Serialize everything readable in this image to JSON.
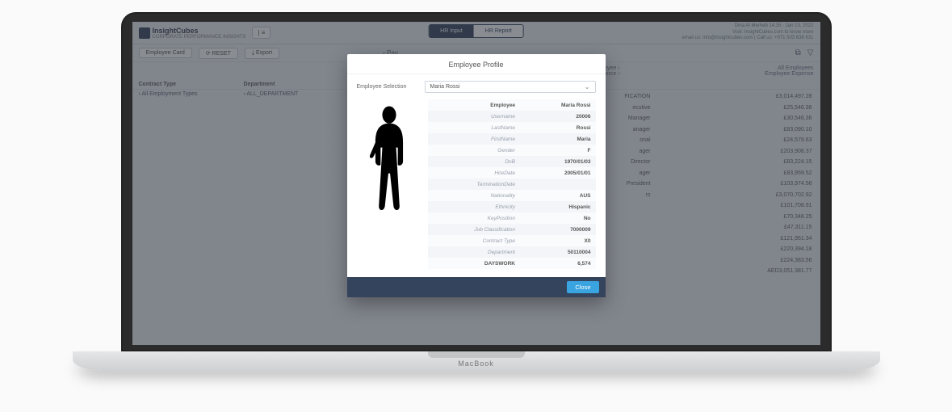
{
  "brand": {
    "name": "InsightCubes",
    "tagline": "CORPORATE PERFORMANCE INSIGHTS"
  },
  "nav": {
    "input": "HR Input",
    "report": "HR Report"
  },
  "header_info": {
    "line1": "Dina Al Merheb    14:35 · Jan 13, 2022",
    "line2": "Visit: InsightCubes.com to know more",
    "line3": "email us: info@insightcubes.com | Call us: +971 503 638 631"
  },
  "toolbar": {
    "employee_card": "Employee Card",
    "reset": "⟳ RESET",
    "export": "⤓ Export",
    "pav_label": "Pav"
  },
  "crumbs": {
    "employee": "Employee",
    "accounts": "Accounts · Manpower & Workforce",
    "all_employees": "All Employees",
    "employee_expense": "Employee Expense"
  },
  "columns": {
    "contract_type": "Contract Type",
    "department": "Department"
  },
  "first_row": {
    "ct": "› All Employment Types",
    "dep": "› ALL_DEPARTMENT"
  },
  "midlabels": [
    "",
    "",
    "FICATION",
    "",
    "",
    "",
    "ecutive",
    "",
    "Manager",
    "anager",
    "",
    "",
    "onal",
    "ager",
    "Director",
    "ager",
    "President",
    "rs"
  ],
  "amounts": [
    "£3,014,497.28",
    "£25,546.36",
    "£30,546.36",
    "£83,090.10",
    "£24,579.63",
    "£203,908.37",
    "£83,224.15",
    "£83,959.52",
    "£103,974.56",
    "£3,070,702.92",
    "£101,708.91",
    "£70,348.25",
    "£47,311.15",
    "£121,951.34",
    "£220,394.18",
    "£224,383.56",
    "AED3,051,381.77"
  ],
  "modal": {
    "title": "Employee Profile",
    "selection_label": "Employee Selection",
    "selected": "Maria Rossi",
    "close": "Close",
    "rows": [
      {
        "label": "Employee",
        "value": "Maria Rossi",
        "strong": true
      },
      {
        "label": "Username",
        "value": "20006"
      },
      {
        "label": "LastName",
        "value": "Rossi"
      },
      {
        "label": "FirstName",
        "value": "Maria"
      },
      {
        "label": "Gender",
        "value": "F"
      },
      {
        "label": "DoB",
        "value": "1970/01/03"
      },
      {
        "label": "HireDate",
        "value": "2005/01/01"
      },
      {
        "label": "TerminationDate",
        "value": ""
      },
      {
        "label": "Nationality",
        "value": "AUS"
      },
      {
        "label": "Ethnicity",
        "value": "Hispanic"
      },
      {
        "label": "KeyPosition",
        "value": "No"
      },
      {
        "label": "Job Classification",
        "value": "7000009"
      },
      {
        "label": "Contract Type",
        "value": "X0"
      },
      {
        "label": "Department",
        "value": "50110004"
      },
      {
        "label": "DAYSWORK",
        "value": "6,574",
        "strong": true
      }
    ]
  },
  "macbook": "MacBook"
}
